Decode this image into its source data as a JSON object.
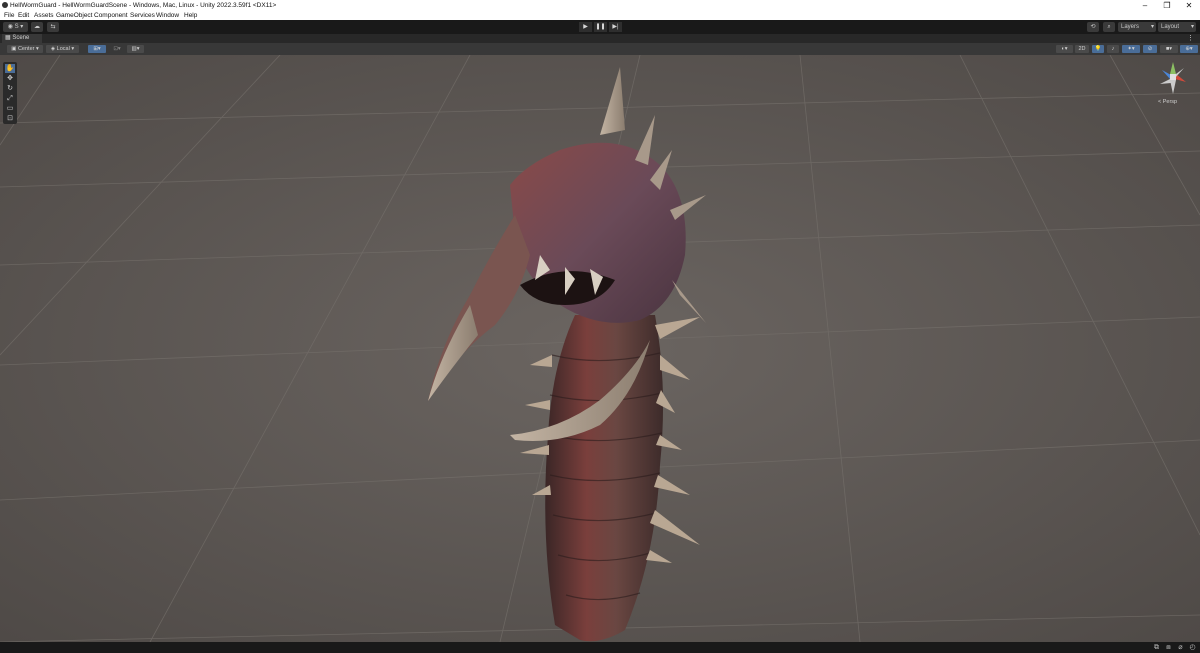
{
  "window": {
    "title": "HellWormGuard - HellWormGuardScene - Windows, Mac, Linux - Unity 2022.3.59f1 <DX11>",
    "minimize": "–",
    "restore": "❐",
    "close": "✕"
  },
  "menu": [
    "File",
    "Edit",
    "Assets",
    "GameObject",
    "Component",
    "Services",
    "Window",
    "Help"
  ],
  "toolbar": {
    "account_label": "S",
    "layers_label": "Layers",
    "layout_label": "Layout"
  },
  "scene_tab": {
    "label": "Scene"
  },
  "scene_toolbar": {
    "pivot_label": "Center",
    "space_label": "Local",
    "mode_2d_label": "2D"
  },
  "gizmo": {
    "persp_label": "< Persp"
  },
  "colors": {
    "viewport_bg": "#5c5652",
    "toolbar_bg": "#191919",
    "accent": "#4a6d98"
  }
}
